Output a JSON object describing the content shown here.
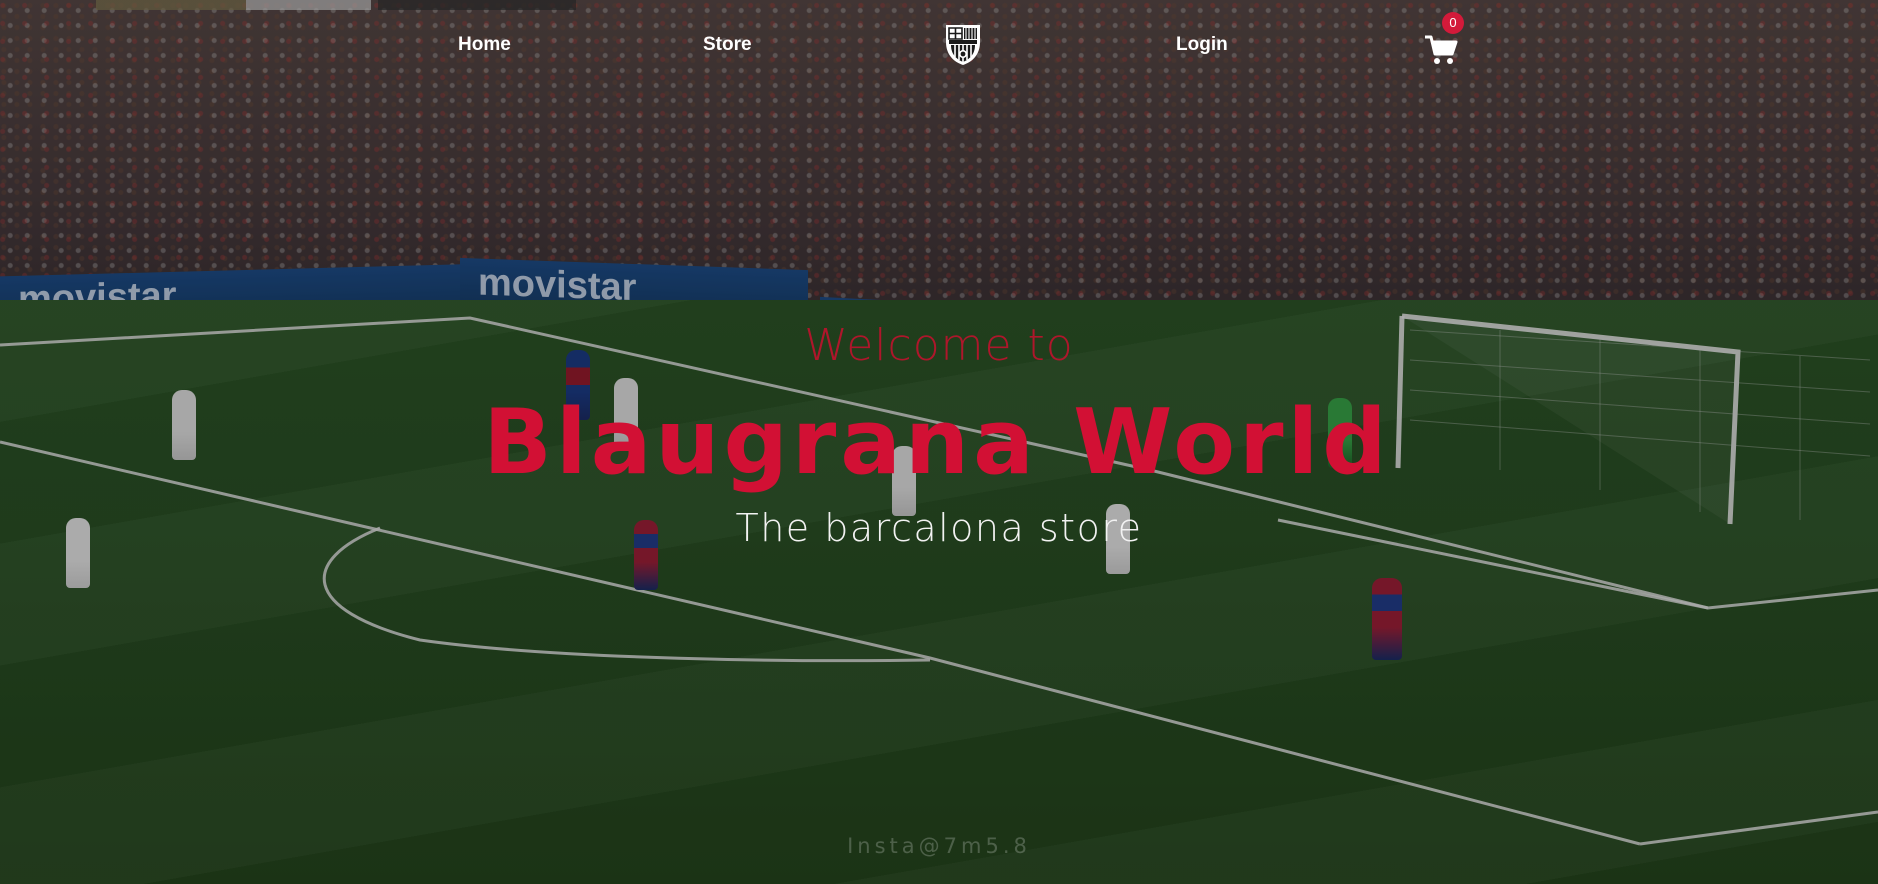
{
  "nav": {
    "home_label": "Home",
    "store_label": "Store",
    "login_label": "Login",
    "cart_count": "0",
    "crest_icon": "barcelona-crest-icon",
    "cart_icon": "shopping-cart-icon"
  },
  "hero": {
    "welcome": "Welcome to",
    "title": "Blaugrana World",
    "subtitle": "The barcalona store",
    "watermark": "Insta@7m5.8"
  },
  "background": {
    "sponsor_board": "movistar"
  },
  "colors": {
    "accent_red": "#d21034",
    "badge_red": "#d31a3a",
    "nav_text": "#ffffff"
  }
}
